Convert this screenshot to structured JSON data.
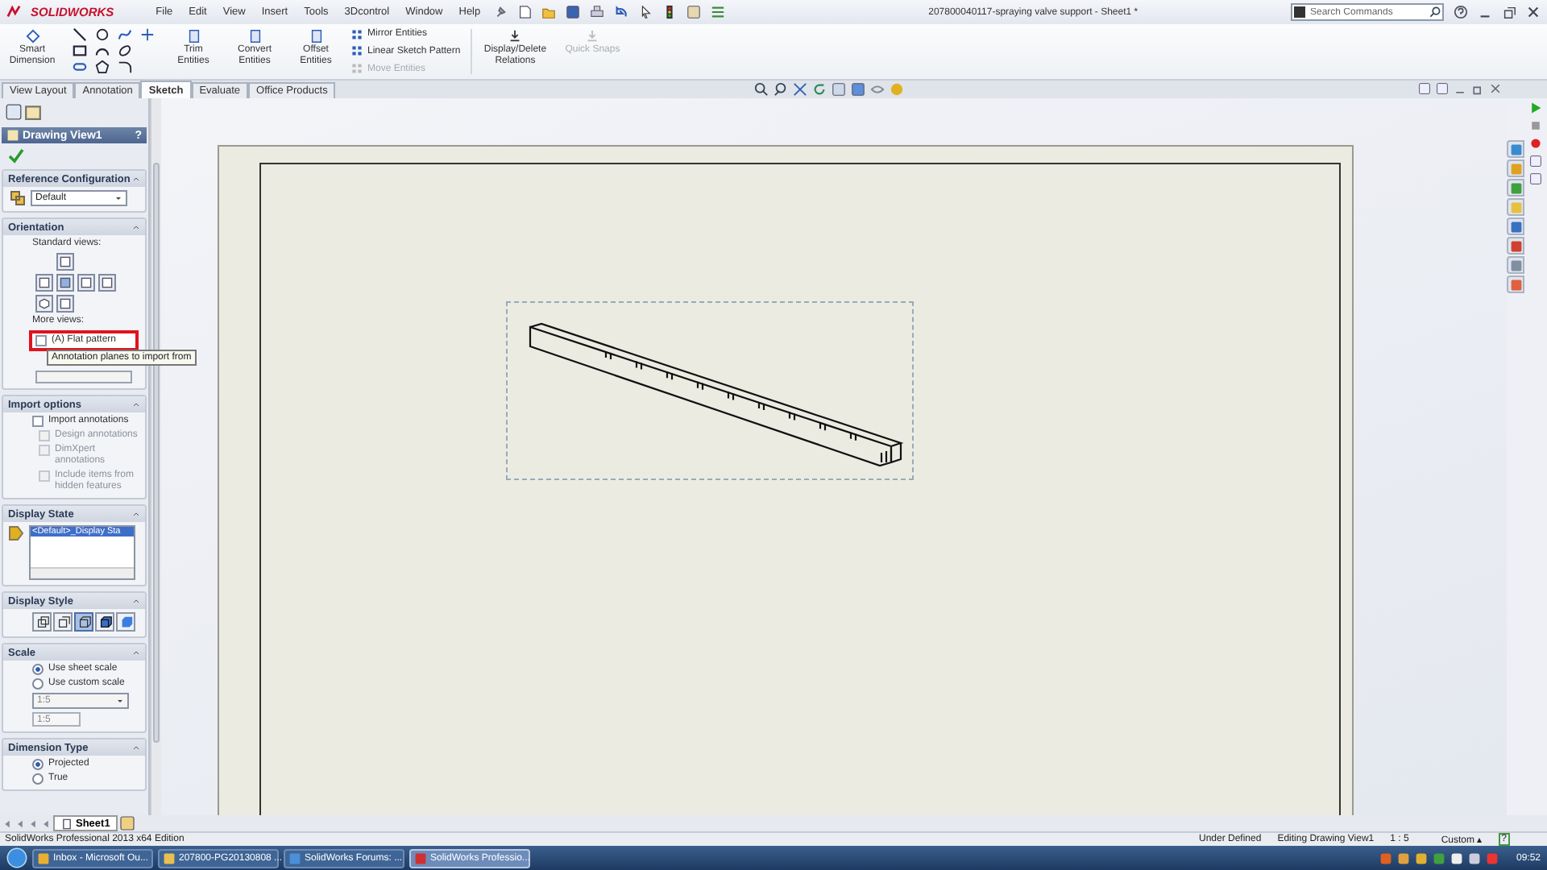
{
  "title_bar": {
    "logo": "SOLIDWORKS",
    "menu": [
      "File",
      "Edit",
      "View",
      "Insert",
      "Tools",
      "3Dcontrol",
      "Window",
      "Help"
    ],
    "document_title": "207800040117-spraying valve support - Sheet1 *",
    "search": {
      "placeholder": "Search Commands"
    }
  },
  "ribbon": {
    "smart_dimension": {
      "label": "Smart Dimension",
      "disabled": false
    },
    "large_tools": [
      {
        "label": "Trim Entities",
        "disabled": false
      },
      {
        "label": "Convert Entities",
        "disabled": false
      },
      {
        "label": "Offset Entities",
        "disabled": false
      }
    ],
    "small_tools": [
      {
        "label": "Mirror Entities",
        "disabled": false
      },
      {
        "label": "Linear Sketch Pattern",
        "disabled": false
      },
      {
        "label": "Move Entities",
        "disabled": true
      }
    ],
    "right_tools": [
      {
        "label": "Display/Delete Relations",
        "disabled": false
      },
      {
        "label": "Quick Snaps",
        "disabled": true
      }
    ]
  },
  "tabs": [
    {
      "label": "View Layout",
      "selected": false
    },
    {
      "label": "Annotation",
      "selected": false
    },
    {
      "label": "Sketch",
      "selected": true
    },
    {
      "label": "Evaluate",
      "selected": false
    },
    {
      "label": "Office Products",
      "selected": false
    }
  ],
  "property_manager": {
    "title": "Drawing View1",
    "help": "?",
    "reference_configuration": {
      "heading": "Reference Configuration",
      "value": "Default"
    },
    "orientation": {
      "heading": "Orientation",
      "standard_label": "Standard views:",
      "more_label": "More views:",
      "more_views": [
        {
          "label": "(A) Flat pattern",
          "checked": false,
          "highlighted": true
        }
      ],
      "tooltip": "Annotation planes to import from"
    },
    "import_options": {
      "heading": "Import options",
      "options": [
        {
          "label": "Import annotations",
          "checked": false,
          "disabled": false
        },
        {
          "label": "Design annotations",
          "checked": false,
          "disabled": true
        },
        {
          "label": "DimXpert annotations",
          "checked": false,
          "disabled": true
        },
        {
          "label": "Include items from hidden features",
          "checked": false,
          "disabled": true
        }
      ]
    },
    "display_state": {
      "heading": "Display State",
      "items": [
        {
          "label": "<Default>_Display Sta",
          "selected": true
        }
      ]
    },
    "display_style": {
      "heading": "Display Style",
      "styles": [
        {
          "kind": "wireframe",
          "selected": false
        },
        {
          "kind": "hidden",
          "selected": false
        },
        {
          "kind": "removed",
          "selected": true
        },
        {
          "kind": "shaded_edges",
          "selected": false
        },
        {
          "kind": "shaded",
          "selected": false
        }
      ]
    },
    "scale": {
      "heading": "Scale",
      "options": [
        {
          "label": "Use sheet scale",
          "selected": true
        },
        {
          "label": "Use custom scale",
          "selected": false
        }
      ],
      "preset": "1:5",
      "custom": "1:5"
    },
    "dimension_type": {
      "heading": "Dimension Type",
      "options": [
        {
          "label": "Projected",
          "selected": true
        },
        {
          "label": "True",
          "selected": false
        }
      ]
    }
  },
  "sheet_tabs": [
    {
      "label": "Sheet1",
      "selected": true
    }
  ],
  "status_bar": {
    "product": "SolidWorks Professional 2013 x64 Edition",
    "state": "Under Defined",
    "mode": "Editing Drawing View1",
    "scale": "1 : 5",
    "units": "Custom",
    "units_caret": "▴",
    "help": "?"
  },
  "taskbar": {
    "items": [
      {
        "label": "Inbox - Microsoft Ou...",
        "selected": false
      },
      {
        "label": "207800-PG20130808 ...",
        "selected": false
      },
      {
        "label": "SolidWorks Forums: ...",
        "selected": false
      },
      {
        "label": "SolidWorks Professio...",
        "selected": true
      }
    ],
    "clock": "09:52"
  }
}
